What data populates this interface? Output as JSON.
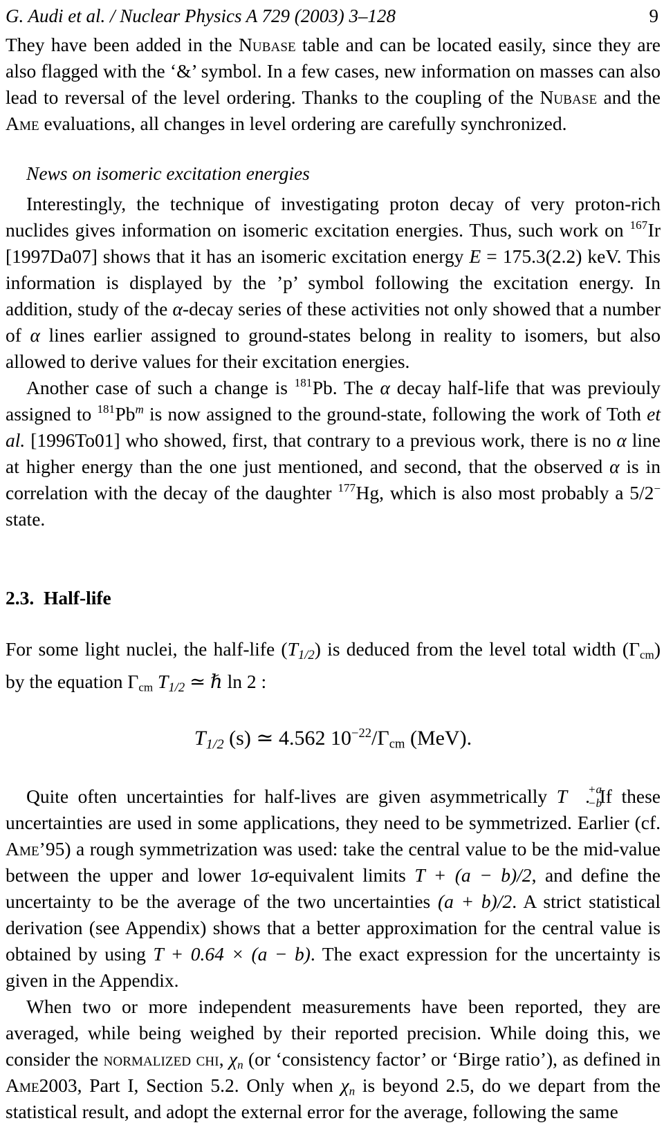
{
  "running_head": {
    "citation": "G. Audi et al. / Nuclear Physics A 729 (2003) 3–128",
    "page_number": "9"
  },
  "paragraphs": {
    "p1": {
      "seg1": "They have been added in the ",
      "acronym1": "Nubase",
      "seg2": " table and can be located easily, since they are also flagged with the ‘&’ symbol. In a few cases, new information on masses can also lead to reversal of the level ordering. Thanks to the coupling of the ",
      "acronym2": "Nubase",
      "seg3": " and the ",
      "acronym3": "Ame",
      "seg4": " evaluations, all changes in level ordering are carefully synchronized."
    },
    "subheading": "News on isomeric excitation energies",
    "p2": {
      "seg1": "Interestingly, the technique of investigating proton decay of very proton-rich nuclides gives information on isomeric excitation energies. Thus, such work on ",
      "nuclide1_mass": "167",
      "nuclide1_symbol": "Ir",
      "seg2": " [1997Da07] shows that it has an isomeric excitation energy ",
      "var_E": "E",
      "eq_E": " = 175.3(2.2) keV. This information is displayed by the ’p’ symbol following the excitation energy. In addition, study of the ",
      "alpha1": "α",
      "seg3": "-decay series of these activities not only showed that a number of ",
      "alpha2": "α",
      "seg4": " lines earlier assigned to ground-states belong in reality to isomers, but also allowed to derive values for their excitation energies."
    },
    "p3": {
      "seg1": "Another case of such a change is ",
      "nuclide1_mass": "181",
      "nuclide1_symbol": "Pb",
      "seg2": ". The ",
      "alpha1": "α",
      "seg3": " decay half-life that was previouly assigned to ",
      "nuclide2_mass": "181",
      "nuclide2_symbol": "Pb",
      "nuclide2_post": "m",
      "seg4": " is now assigned to the ground-state, following the work of Toth ",
      "italic_etal": "et al.",
      "seg5": " [1996To01] who showed, first, that contrary to a previous work, there is no ",
      "alpha2": "α",
      "seg6": " line at higher energy than the one just mentioned, and second, that the observed ",
      "alpha3": "α",
      "seg7": " is in correlation with the decay of the daughter ",
      "nuclide3_mass": "177",
      "nuclide3_symbol": "Hg",
      "seg8": ", which is also most probably a 5/2",
      "minus_sup": "−",
      "seg9": " state."
    }
  },
  "section": {
    "number": "2.3.",
    "title": "Half-life"
  },
  "p4": {
    "seg1": "For some light nuclei, the half-life (",
    "T": "T",
    "Thalf_sub": "1/2",
    "seg2": ") is deduced from the level total width (",
    "Gamma": "Γ",
    "Gamma_sub": "cm",
    "seg3": ") by the equation ",
    "seg4": " ≃ ℏ ln 2 :"
  },
  "equation": {
    "T": "T",
    "T_sub": "1/2",
    "unit_s": "(s)",
    "approx": "≃",
    "coefficient": "4.562 10",
    "exponent": "−22",
    "slash": "/",
    "Gamma": "Γ",
    "Gamma_sub": "cm",
    "unit_mev": "(MeV).",
    "full_text": "T1/2 (s) ≃ 4.562 10−22 /Γcm (MeV)."
  },
  "p5": {
    "seg1": "Quite often uncertainties for half-lives are given asymmetrically ",
    "T": "T",
    "sup_a": "+a",
    "sub_b": "−b",
    "seg2": ". If these uncertainties are used in some applications, they need to be symmetrized. Earlier (cf. ",
    "acronym_ame": "Ame",
    "seg3": "’95) a rough symmetrization was used: take the central value to be the mid-value between the upper and lower 1",
    "sigma": "σ",
    "seg4": "-equivalent limits ",
    "expr1": "T + (a − b)/2",
    "seg5": ", and define the uncertainty to be the average of the two uncertainties ",
    "expr2": "(a + b)/2",
    "seg6": ". A strict statistical derivation (see Appendix) shows that a better approximation for the central value is obtained by using ",
    "expr3": "T + 0.64 × (a − b)",
    "seg7": ". The exact expression for the uncertainty is given in the Appendix."
  },
  "p6": {
    "seg1": "When two or more independent measurements have been reported, they are averaged, while being weighed by their reported precision. While doing this, we consider the ",
    "term_normalized_chi": "normalized chi",
    "seg2": ", ",
    "chi": "χ",
    "chi_sub": "n",
    "seg3": " (or ‘consistency factor’ or ‘Birge ratio’), as defined in ",
    "acronym_ame": "Ame",
    "seg4": "2003, Part I, Section 5.2. Only when ",
    "chi2": "χ",
    "chi2_sub": "n",
    "seg5": " is beyond 2.5, do we depart from the statistical result, and adopt the external error for the average, following the same"
  }
}
